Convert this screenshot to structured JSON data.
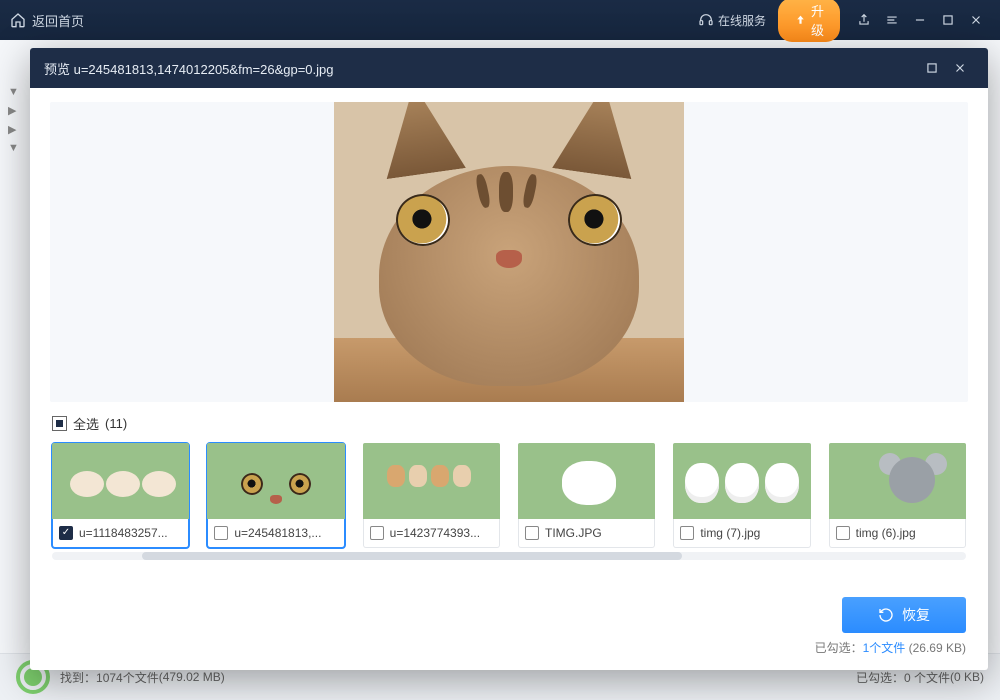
{
  "titlebar": {
    "home": "返回首页",
    "online_service": "在线服务",
    "upgrade": "升级"
  },
  "sidebar": {
    "items": [
      "▼",
      "",
      "▶",
      "",
      "▶",
      "",
      "▼"
    ]
  },
  "modal": {
    "title": "预览 u=245481813,1474012205&fm=26&gp=0.jpg",
    "select_all_label": "全选",
    "select_all_count": "(11)",
    "thumbs": [
      {
        "name": "u=1118483257...",
        "checked": true
      },
      {
        "name": "u=245481813,...",
        "checked": false
      },
      {
        "name": "u=1423774393...",
        "checked": false
      },
      {
        "name": "TIMG.JPG",
        "checked": false
      },
      {
        "name": "timg (7).jpg",
        "checked": false
      },
      {
        "name": "timg (6).jpg",
        "checked": false
      }
    ],
    "recover": "恢复",
    "selected_prefix": "已勾选：",
    "selected_count": "1个文件",
    "selected_size": " (26.69 KB)"
  },
  "footer": {
    "found_prefix": "找到：",
    "found_files": "1074个文件",
    "found_size": " (479.02 MB)",
    "right_prefix": "已勾选：",
    "right_count": "0 个文件",
    "right_size": " (0 KB)"
  }
}
